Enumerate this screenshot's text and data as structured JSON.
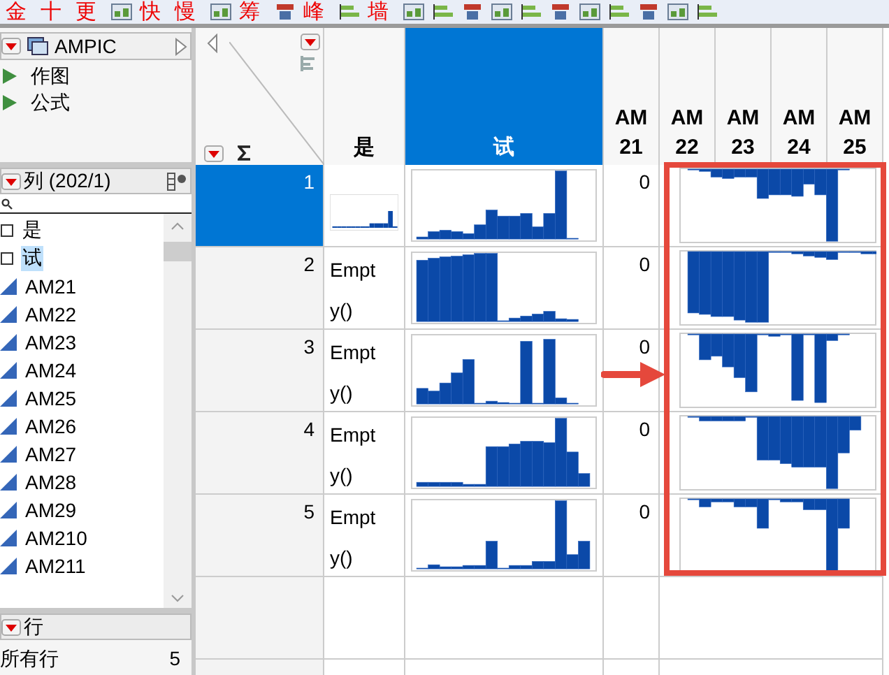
{
  "toolbar": {
    "items": [
      {
        "kind": "text",
        "label": "金"
      },
      {
        "kind": "text",
        "label": "十"
      },
      {
        "kind": "text",
        "label": "更"
      },
      {
        "kind": "icon"
      },
      {
        "kind": "text",
        "label": "快"
      },
      {
        "kind": "text",
        "label": "慢"
      },
      {
        "kind": "icon"
      },
      {
        "kind": "text",
        "label": "筹"
      },
      {
        "kind": "icon"
      },
      {
        "kind": "text",
        "label": "峰"
      },
      {
        "kind": "icon"
      },
      {
        "kind": "text",
        "label": "墙"
      },
      {
        "kind": "icon"
      },
      {
        "kind": "icon"
      },
      {
        "kind": "icon"
      },
      {
        "kind": "icon"
      },
      {
        "kind": "icon"
      },
      {
        "kind": "icon"
      },
      {
        "kind": "icon"
      },
      {
        "kind": "icon"
      },
      {
        "kind": "icon"
      },
      {
        "kind": "icon"
      },
      {
        "kind": "icon"
      }
    ]
  },
  "table_panel": {
    "title": "AMPIC",
    "scripts": [
      {
        "label": "作图"
      },
      {
        "label": "公式"
      }
    ]
  },
  "columns_panel": {
    "title": "列 (202/1)",
    "columns": [
      {
        "label": "是",
        "kind": "checkbox",
        "selected": false
      },
      {
        "label": "试",
        "kind": "checkbox",
        "selected": true
      },
      {
        "label": "AM21",
        "kind": "continuous",
        "selected": false
      },
      {
        "label": "AM22",
        "kind": "continuous",
        "selected": false
      },
      {
        "label": "AM23",
        "kind": "continuous",
        "selected": false
      },
      {
        "label": "AM24",
        "kind": "continuous",
        "selected": false
      },
      {
        "label": "AM25",
        "kind": "continuous",
        "selected": false
      },
      {
        "label": "AM26",
        "kind": "continuous",
        "selected": false
      },
      {
        "label": "AM27",
        "kind": "continuous",
        "selected": false
      },
      {
        "label": "AM28",
        "kind": "continuous",
        "selected": false
      },
      {
        "label": "AM29",
        "kind": "continuous",
        "selected": false
      },
      {
        "label": "AM210",
        "kind": "continuous",
        "selected": false
      },
      {
        "label": "AM211",
        "kind": "continuous",
        "selected": false
      }
    ]
  },
  "rows_panel": {
    "title": "行",
    "items": [
      {
        "label": "所有行",
        "count": "5"
      }
    ]
  },
  "table": {
    "columns": [
      {
        "label": "是",
        "selected": false
      },
      {
        "label": "试",
        "selected": true
      },
      {
        "label": "AM21",
        "selected": false
      },
      {
        "label": "AM22",
        "selected": false
      },
      {
        "label": "AM23",
        "selected": false
      },
      {
        "label": "AM24",
        "selected": false
      },
      {
        "label": "AM25",
        "selected": false
      }
    ],
    "rows": [
      {
        "label": "1",
        "selected": true,
        "cells": [
          {
            "kind": "sparkline"
          },
          {
            "kind": "sparkline"
          },
          {
            "kind": "text",
            "text": "0"
          },
          {
            "kind": "wide_sparkline"
          }
        ]
      },
      {
        "label": "2",
        "selected": false,
        "cells": [
          {
            "kind": "text",
            "text": "Empty()"
          },
          {
            "kind": "sparkline"
          },
          {
            "kind": "text",
            "text": "0"
          },
          {
            "kind": "wide_sparkline"
          }
        ]
      },
      {
        "label": "3",
        "selected": false,
        "cells": [
          {
            "kind": "text",
            "text": "Empty()"
          },
          {
            "kind": "sparkline"
          },
          {
            "kind": "text",
            "text": "0"
          },
          {
            "kind": "wide_sparkline"
          }
        ]
      },
      {
        "label": "4",
        "selected": false,
        "cells": [
          {
            "kind": "text",
            "text": "Empty()"
          },
          {
            "kind": "sparkline"
          },
          {
            "kind": "text",
            "text": "0"
          },
          {
            "kind": "wide_sparkline"
          }
        ]
      },
      {
        "label": "5",
        "selected": false,
        "cells": [
          {
            "kind": "text",
            "text": "Empty()"
          },
          {
            "kind": "sparkline"
          },
          {
            "kind": "text",
            "text": "0"
          },
          {
            "kind": "wide_sparkline"
          }
        ]
      }
    ]
  },
  "annotations": {
    "highlight_box": true,
    "arrow": true
  }
}
